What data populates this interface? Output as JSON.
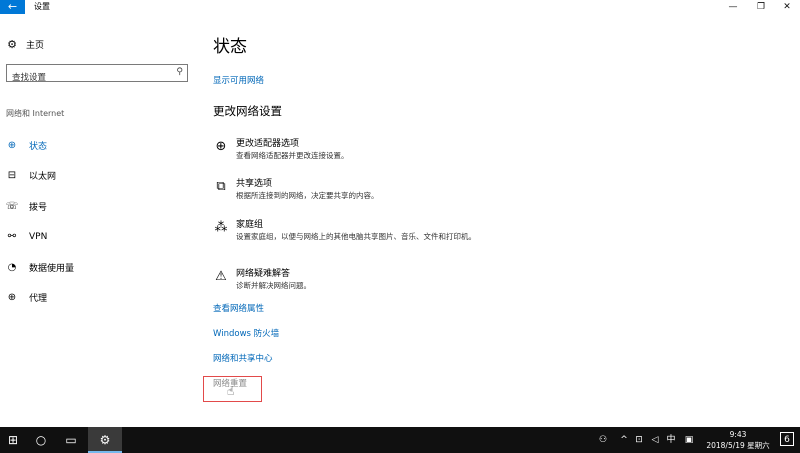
{
  "window": {
    "title": "设置",
    "back_icon": "←",
    "minimize_icon": "—",
    "maximize_icon": "❐",
    "close_icon": "✕"
  },
  "sidebar": {
    "home_label": "主页",
    "search_placeholder": "查找设置",
    "section_label": "网络和 Internet",
    "items": [
      {
        "label": "状态",
        "icon": "globe-status-icon",
        "active": true
      },
      {
        "label": "以太网",
        "icon": "ethernet-icon",
        "active": false
      },
      {
        "label": "拨号",
        "icon": "dialup-icon",
        "active": false
      },
      {
        "label": "VPN",
        "icon": "vpn-icon",
        "active": false
      },
      {
        "label": "数据使用量",
        "icon": "data-usage-icon",
        "active": false
      },
      {
        "label": "代理",
        "icon": "proxy-icon",
        "active": false
      }
    ]
  },
  "main": {
    "title": "状态",
    "show_networks_link": "显示可用网络",
    "section_heading": "更改网络设置",
    "options": [
      {
        "title": "更改适配器选项",
        "desc": "查看网络适配器并更改连接设置。",
        "icon": "adapter-icon"
      },
      {
        "title": "共享选项",
        "desc": "根据所连接到的网络，决定要共享的内容。",
        "icon": "sharing-icon"
      },
      {
        "title": "家庭组",
        "desc": "设置家庭组，以便与网络上的其他电脑共享图片、音乐、文件和打印机。",
        "icon": "homegroup-icon"
      },
      {
        "title": "网络疑难解答",
        "desc": "诊断并解决网络问题。",
        "icon": "troubleshoot-icon"
      }
    ],
    "links": {
      "view_properties": "查看网络属性",
      "firewall": "Windows 防火墙",
      "sharing_center": "网络和共享中心",
      "network_reset": "网络重置"
    }
  },
  "taskbar": {
    "clock_time": "9:43",
    "clock_date": "2018/5/19 星期六",
    "ime_label": "中",
    "notification_count": "6",
    "accent_color": "#0078d7"
  }
}
